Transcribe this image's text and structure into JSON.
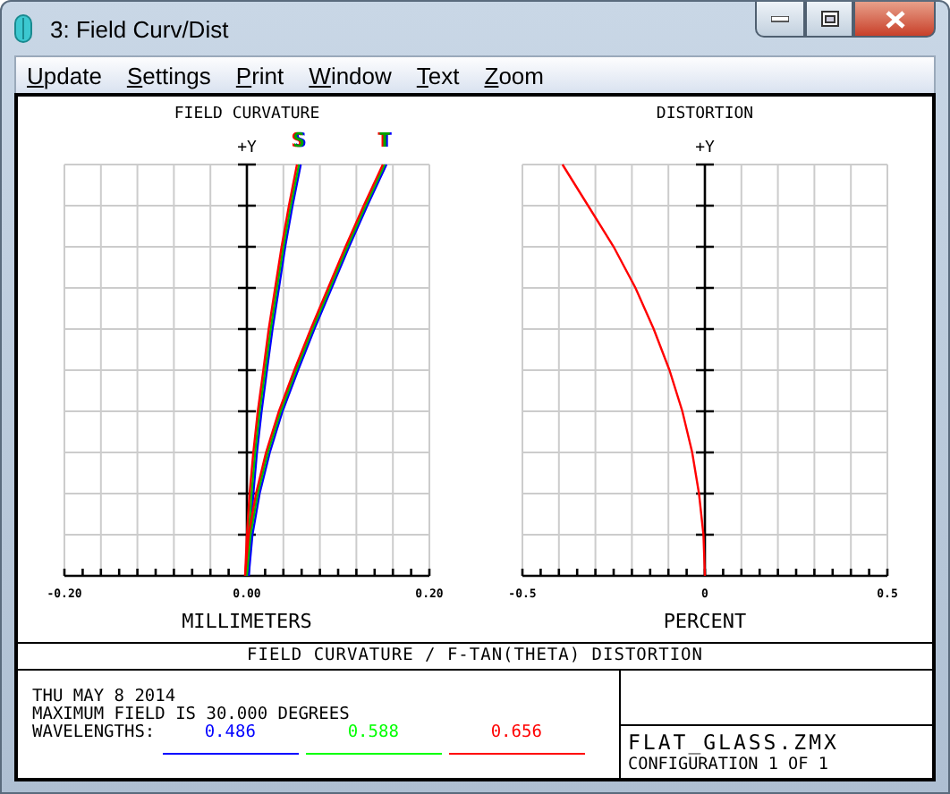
{
  "window": {
    "title": "3: Field Curv/Dist"
  },
  "menu": [
    {
      "label": "Update"
    },
    {
      "label": "Settings"
    },
    {
      "label": "Print"
    },
    {
      "label": "Window"
    },
    {
      "label": "Text"
    },
    {
      "label": "Zoom"
    }
  ],
  "plots": [
    {
      "kind": "field_curvature",
      "title": "FIELD CURVATURE",
      "axis_label": "+Y",
      "xlabel": "MILLIMETERS",
      "ticks": [
        "-0.20",
        "0.00",
        "0.20"
      ],
      "curve_labels": [
        "S",
        "T"
      ]
    },
    {
      "kind": "distortion",
      "title": "DISTORTION",
      "axis_label": "+Y",
      "xlabel": "PERCENT",
      "ticks": [
        "-0.5",
        "0",
        "0.5"
      ]
    }
  ],
  "caption": "FIELD CURVATURE / F-TAN(THETA) DISTORTION",
  "info": {
    "date": "THU MAY 8 2014",
    "field": "MAXIMUM FIELD IS 30.000 DEGREES",
    "wavelengths_label": "WAVELENGTHS:",
    "wavelengths": [
      {
        "value": "0.486",
        "color": "#0000ff"
      },
      {
        "value": "0.588",
        "color": "#00ff00"
      },
      {
        "value": "0.656",
        "color": "#ff0000"
      }
    ]
  },
  "file": {
    "name": "FLAT_GLASS.ZMX",
    "configuration": "CONFIGURATION 1 OF 1"
  }
}
